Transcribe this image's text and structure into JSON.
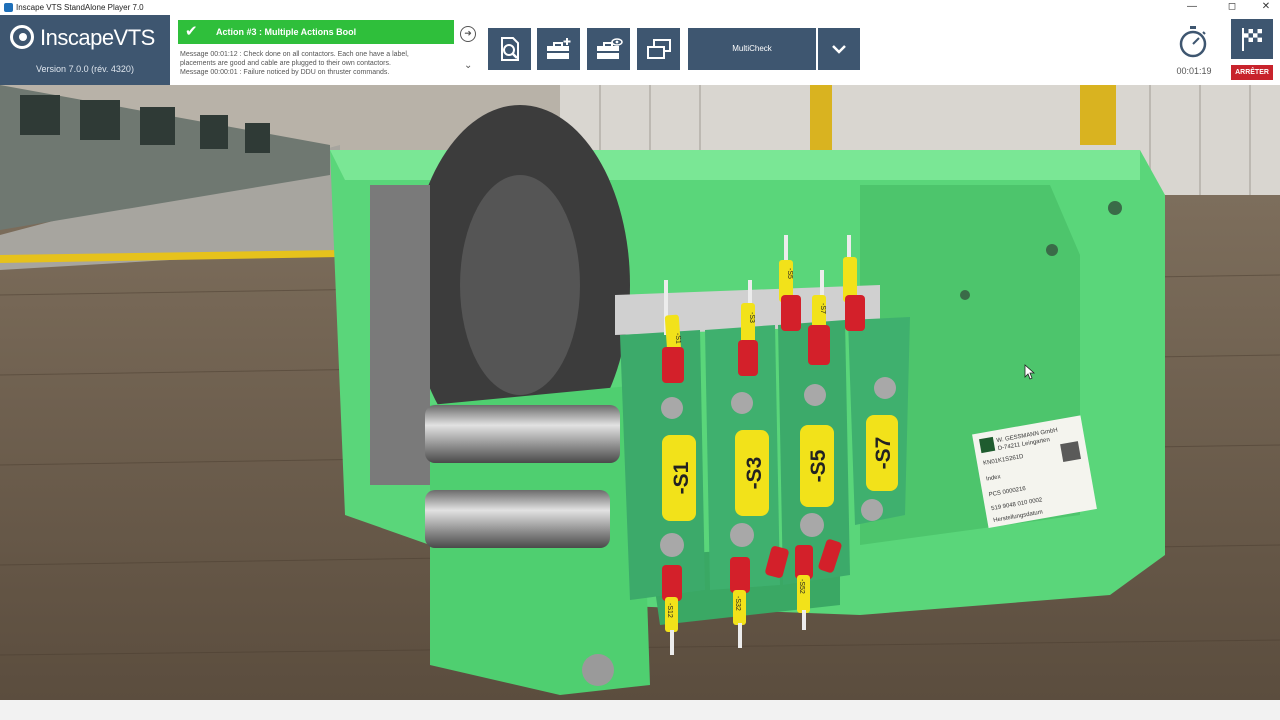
{
  "window": {
    "title": "Inscape VTS StandAlone Player 7.0",
    "minimize": "—",
    "maximize": "◻",
    "close": "✕"
  },
  "logo": {
    "name": "InscapeVTS",
    "version": "Version 7.0.0  (rév. 4320)"
  },
  "action": {
    "status_icon": "check-icon",
    "label": "Action #3 : Multiple Actions Bool"
  },
  "messages": [
    "Message 00:01:12 : Check done on all contactors. Each one have a label,",
    "placements are good and cable are plugged to their own contactors.",
    "Message 00:00:01 : Failure noticed by DDU on thruster commands."
  ],
  "tools": [
    {
      "name": "inspect-document-icon"
    },
    {
      "name": "add-toolbox-icon"
    },
    {
      "name": "view-toolbox-icon"
    },
    {
      "name": "windows-icon"
    }
  ],
  "mode_select": {
    "value": "MultiCheck"
  },
  "timer": {
    "value": "00:01:19"
  },
  "stop_button": {
    "label": "ARRÊTER"
  },
  "scene": {
    "contactor_labels": [
      "-S1",
      "-S3",
      "-S5",
      "-S7"
    ],
    "top_wire_labels": [
      "-S1",
      "-S3",
      "-S5",
      "-S7"
    ],
    "bottom_wire_labels": [
      "-S12",
      "-S32",
      "-S52",
      "-S72"
    ],
    "nameplate": {
      "maker": "W. GESSMANN GmbH",
      "address": "D-74211 Leingarten",
      "code1": "KN01K1S261D",
      "line2": "Index",
      "code2": "PCS 0000216",
      "code3": "519 9048 010 0002",
      "line5": "Herstellungsdatum"
    },
    "colors": {
      "housing": "#5ad67a",
      "contactor": "#3caa6a",
      "label": "#f2e21a",
      "wire_red": "#d3202a"
    }
  }
}
